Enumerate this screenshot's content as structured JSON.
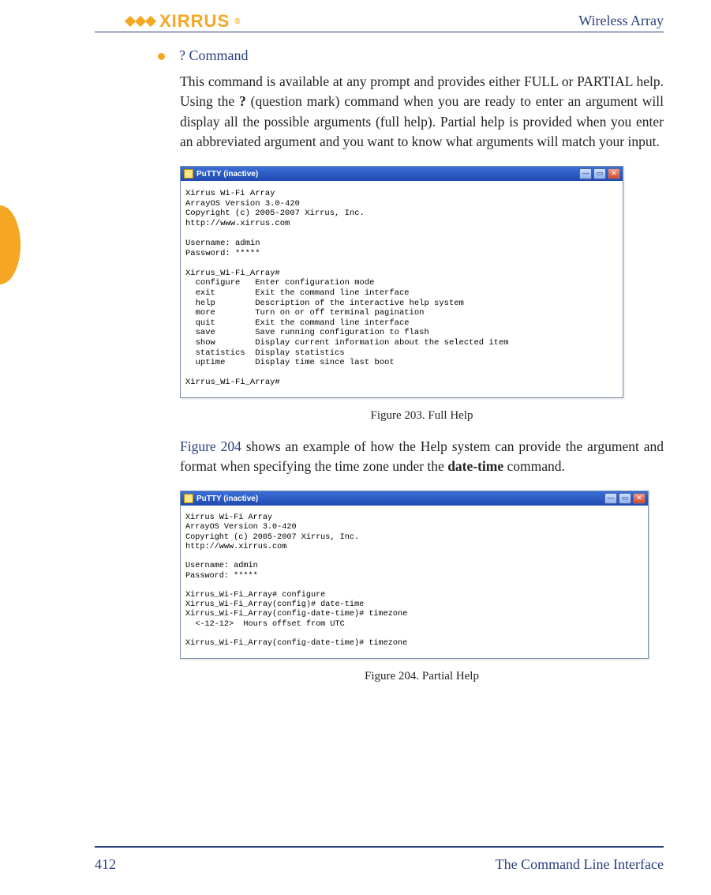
{
  "header": {
    "logoText": "XIRRUS",
    "docTitle": "Wireless Array"
  },
  "bullet": {
    "heading": "? Command"
  },
  "para1_parts": {
    "a": "This command is available at any prompt and provides either FULL or PARTIAL help. Using the ",
    "q": "?",
    "b": " (question mark) command when you are ready to enter an argument will display all the possible arguments (full help). Partial help is provided when you enter an abbreviated argument and you want to know what arguments will match your input."
  },
  "putty1": {
    "title": "PuTTY (inactive)",
    "text": "Xirrus Wi-Fi Array\nArrayOS Version 3.0-420\nCopyright (c) 2005-2007 Xirrus, Inc.\nhttp://www.xirrus.com\n\nUsername: admin\nPassword: *****\n\nXirrus_Wi-Fi_Array#\n  configure   Enter configuration mode\n  exit        Exit the command line interface\n  help        Description of the interactive help system\n  more        Turn on or off terminal pagination\n  quit        Exit the command line interface\n  save        Save running configuration to flash\n  show        Display current information about the selected item\n  statistics  Display statistics\n  uptime      Display time since last boot\n\nXirrus_Wi-Fi_Array#"
  },
  "fig203": "Figure 203. Full Help",
  "para2_parts": {
    "ref": "Figure 204 ",
    "a": " shows an example of how the Help system can provide the argument and format when specifying the time zone under the ",
    "d": "date-time",
    "b": " command."
  },
  "putty2": {
    "title": "PuTTY (inactive)",
    "text": "Xirrus Wi-Fi Array\nArrayOS Version 3.0-420\nCopyright (c) 2005-2007 Xirrus, Inc.\nhttp://www.xirrus.com\n\nUsername: admin\nPassword: *****\n\nXirrus_Wi-Fi_Array# configure\nXirrus_Wi-Fi_Array(config)# date-time\nXirrus_Wi-Fi_Array(config-date-time)# timezone\n  <-12-12>  Hours offset from UTC\n\nXirrus_Wi-Fi_Array(config-date-time)# timezone"
  },
  "fig204": "Figure 204. Partial Help",
  "footer": {
    "pageNumber": "412",
    "sectionName": "The Command Line Interface"
  },
  "glyphs": {
    "min": "—",
    "max": "▭",
    "close": "✕"
  }
}
